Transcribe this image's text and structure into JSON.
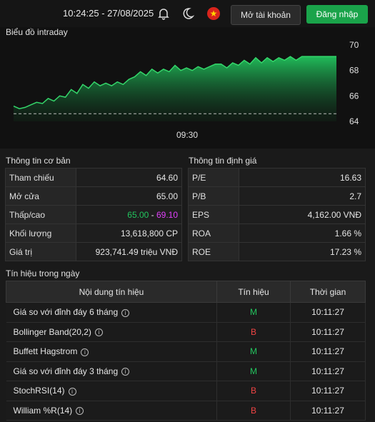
{
  "header": {
    "datetime": "10:24:25 - 27/08/2025",
    "open_account": "Mở tài khoản",
    "login": "Đăng nhập",
    "icons": [
      "bell-icon",
      "moon-icon",
      "vietnam-flag-icon"
    ]
  },
  "chart_data": {
    "type": "area",
    "title": "Biểu đồ intraday",
    "y_ticks": [
      "70",
      "68",
      "66",
      "64"
    ],
    "ylim": [
      64,
      70.5
    ],
    "x_tick": "09:30",
    "reference_line": 64.6,
    "values": [
      65.2,
      65.0,
      65.1,
      65.3,
      65.5,
      65.4,
      65.8,
      65.6,
      66.0,
      65.9,
      66.5,
      66.2,
      66.9,
      66.6,
      67.1,
      66.8,
      67.0,
      66.8,
      67.1,
      66.9,
      67.3,
      67.5,
      67.9,
      67.6,
      68.1,
      67.8,
      68.1,
      67.9,
      68.4,
      68.0,
      68.2,
      68.0,
      68.3,
      68.1,
      68.3,
      68.5,
      68.5,
      68.2,
      68.6,
      68.4,
      68.8,
      68.5,
      69.0,
      68.6,
      69.0,
      68.7,
      69.0,
      68.8,
      69.1,
      68.8,
      69.1,
      69.1,
      69.1,
      69.1,
      69.1,
      69.1,
      69.1
    ]
  },
  "basic_info": {
    "title": "Thông tin cơ bản",
    "rows": [
      {
        "label": "Tham chiếu",
        "value": "64.60"
      },
      {
        "label": "Mở cửa",
        "value": "65.00"
      },
      {
        "label": "Thấp/cao",
        "low": "65.00",
        "sep": " - ",
        "high": "69.10"
      },
      {
        "label": "Khối lượng",
        "value": "13,618,800 CP"
      },
      {
        "label": "Giá trị",
        "value": "923,741.49 triệu VNĐ"
      }
    ]
  },
  "valuation": {
    "title": "Thông tin định giá",
    "rows": [
      {
        "label": "P/E",
        "value": "16.63"
      },
      {
        "label": "P/B",
        "value": "2.7"
      },
      {
        "label": "EPS",
        "value": "4,162.00 VNĐ"
      },
      {
        "label": "ROA",
        "value": "1.66 %"
      },
      {
        "label": "ROE",
        "value": "17.23 %"
      }
    ]
  },
  "signals": {
    "title": "Tín hiệu trong ngày",
    "headers": [
      "Nội dung tín hiệu",
      "Tín hiệu",
      "Thời gian"
    ],
    "rows": [
      {
        "name": "Giá so với đỉnh đáy 6 tháng",
        "signal": "M",
        "time": "10:11:27"
      },
      {
        "name": "Bollinger Band(20,2)",
        "signal": "B",
        "time": "10:11:27"
      },
      {
        "name": "Buffett Hagstrom",
        "signal": "M",
        "time": "10:11:27"
      },
      {
        "name": "Giá so với đỉnh đáy 3 tháng",
        "signal": "M",
        "time": "10:11:27"
      },
      {
        "name": "StochRSI(14)",
        "signal": "B",
        "time": "10:11:27"
      },
      {
        "name": "William %R(14)",
        "signal": "B",
        "time": "10:11:27"
      }
    ],
    "info_glyph": "i"
  }
}
